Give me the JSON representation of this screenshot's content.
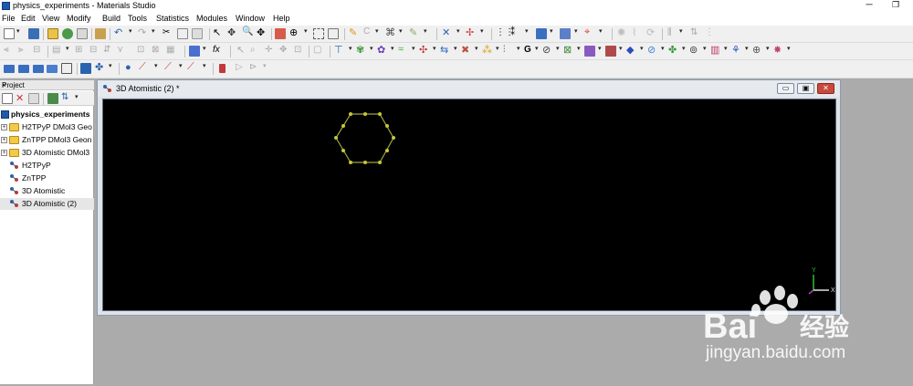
{
  "window": {
    "title": "physics_experiments - Materials Studio",
    "minimize": "─",
    "maximize": "❐"
  },
  "menu": [
    "File",
    "Edit",
    "View",
    "Modify",
    "Build",
    "Tools",
    "Statistics",
    "Modules",
    "Window",
    "Help"
  ],
  "project": {
    "header": "Project",
    "close": "×",
    "items": [
      {
        "label": "physics_experiments",
        "type": "root",
        "bold": true
      },
      {
        "label": "H2TPyP DMol3 Geo",
        "type": "folder",
        "expand": "+"
      },
      {
        "label": "ZnTPP DMol3 Geon",
        "type": "folder",
        "expand": "+"
      },
      {
        "label": "3D Atomistic DMol3",
        "type": "folder",
        "expand": "+"
      },
      {
        "label": "H2TPyP",
        "type": "doc"
      },
      {
        "label": "ZnTPP",
        "type": "doc"
      },
      {
        "label": "3D Atomistic",
        "type": "doc"
      },
      {
        "label": "3D Atomistic (2)",
        "type": "doc",
        "selected": true
      }
    ]
  },
  "document": {
    "title": "3D Atomistic (2) *",
    "controls": {
      "minimize": "▭",
      "restore": "▣",
      "close": "✕"
    },
    "viewport_bg": "#000000",
    "axes": {
      "x": "X",
      "y": "Y"
    },
    "molecule": {
      "atom_color": "#c8c832",
      "bond_color": "#a0a048",
      "ring": "hexagon",
      "atoms": 12
    }
  },
  "watermark": {
    "brand_text": "Bai",
    "brand_suffix": "经验",
    "url": "jingyan.baidu.com"
  },
  "colors": {
    "accent": "#1e5aa8",
    "folder": "#f3c94b",
    "close_red": "#c84a3c"
  }
}
